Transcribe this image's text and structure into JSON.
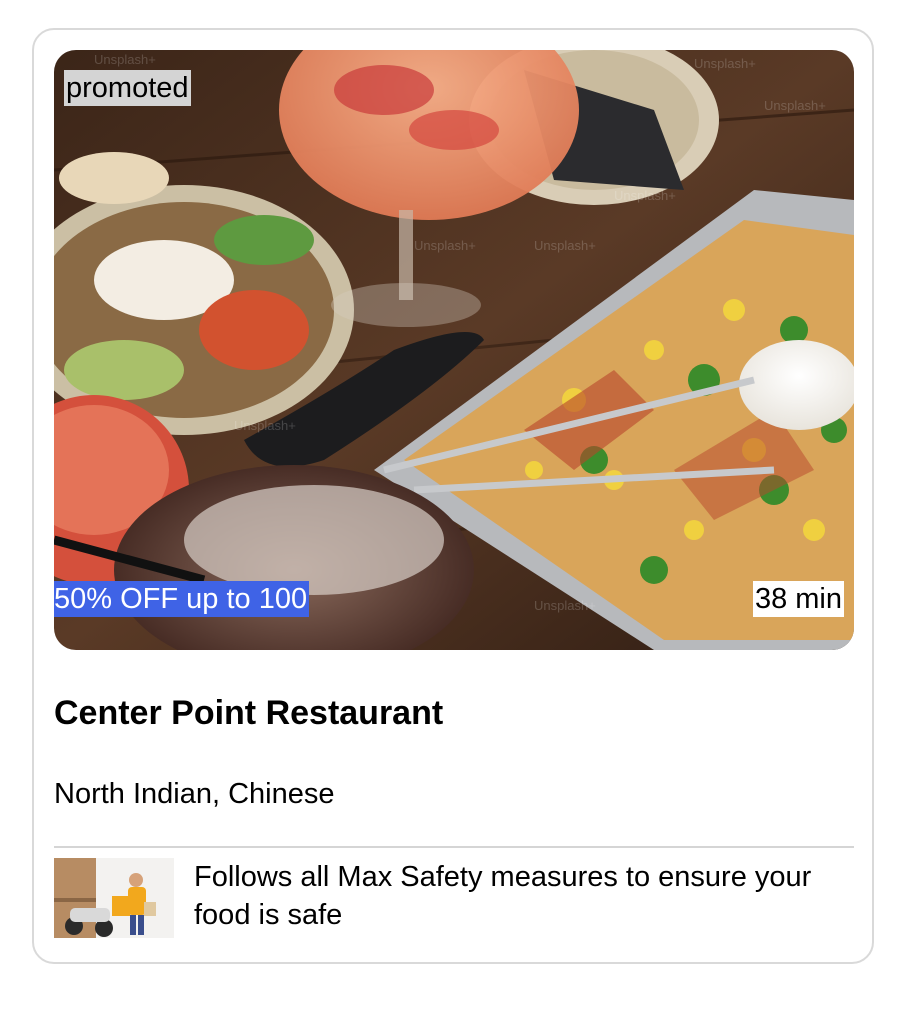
{
  "card": {
    "promoted_label": "promoted",
    "offer_label": "50% OFF up to 100",
    "delivery_time": "38 min",
    "restaurant_name": "Center Point Restaurant",
    "cuisines": "North Indian, Chinese",
    "safety_message": "Follows all Max Safety measures to ensure your food is safe",
    "hero_watermark": "Unsplash+"
  },
  "colors": {
    "offer_badge": "#3f63e6",
    "promoted_badge": "#d4d4d4",
    "card_border": "#d9d9d9"
  }
}
